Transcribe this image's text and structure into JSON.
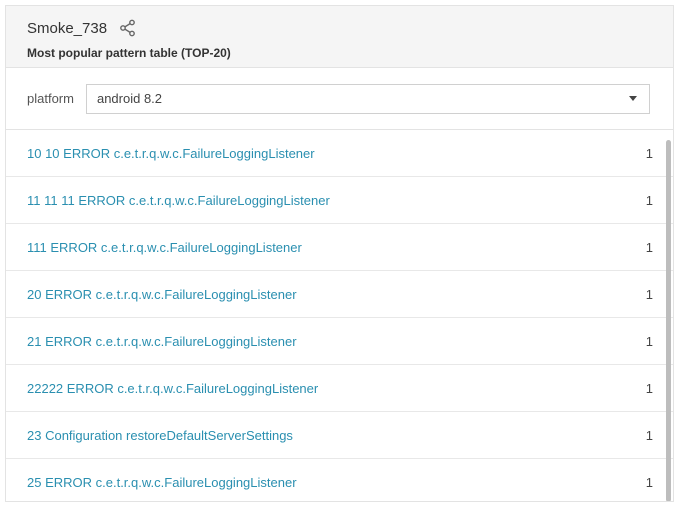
{
  "widget": {
    "title": "Smoke_738",
    "subtitle": "Most popular pattern table (TOP-20)",
    "share_icon": "share-icon"
  },
  "filter": {
    "label": "platform",
    "selected": "android 8.2"
  },
  "rows": [
    {
      "pattern": "10 10 ERROR c.e.t.r.q.w.c.FailureLoggingListener",
      "count": "1"
    },
    {
      "pattern": "11 11 11 ERROR c.e.t.r.q.w.c.FailureLoggingListener",
      "count": "1"
    },
    {
      "pattern": "111 ERROR c.e.t.r.q.w.c.FailureLoggingListener",
      "count": "1"
    },
    {
      "pattern": "20 ERROR c.e.t.r.q.w.c.FailureLoggingListener",
      "count": "1"
    },
    {
      "pattern": "21 ERROR c.e.t.r.q.w.c.FailureLoggingListener",
      "count": "1"
    },
    {
      "pattern": "22222 ERROR c.e.t.r.q.w.c.FailureLoggingListener",
      "count": "1"
    },
    {
      "pattern": "23 Configuration restoreDefaultServerSettings",
      "count": "1"
    },
    {
      "pattern": "25 ERROR c.e.t.r.q.w.c.FailureLoggingListener",
      "count": "1"
    }
  ],
  "colors": {
    "link": "#2a8fb0",
    "header_bg": "#f5f5f5"
  }
}
